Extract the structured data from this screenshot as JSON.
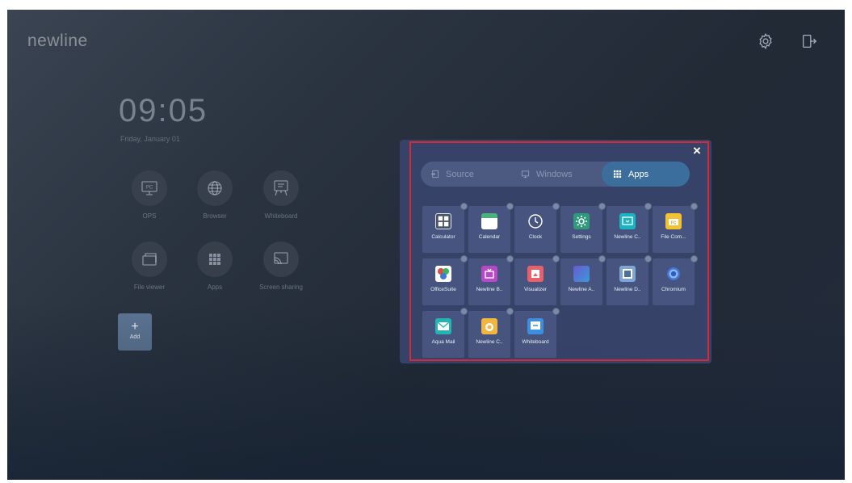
{
  "brand": {
    "logo_text": "newline"
  },
  "top_icons": [
    "gear-icon",
    "exit-icon"
  ],
  "clock": {
    "time": "09:05",
    "date": "Friday, January 01"
  },
  "home": {
    "tiles": [
      {
        "label": "OPS",
        "icon": "pc-icon"
      },
      {
        "label": "Browser",
        "icon": "globe-icon"
      },
      {
        "label": "Whiteboard",
        "icon": "whiteboard-icon"
      },
      {
        "label": "File viewer",
        "icon": "folder-icon"
      },
      {
        "label": "Apps",
        "icon": "apps-grid-icon"
      },
      {
        "label": "Screen sharing",
        "icon": "cast-icon"
      }
    ],
    "add": {
      "plus": "+",
      "label": "Add"
    }
  },
  "panel": {
    "close": "×",
    "tabs": [
      {
        "label": "Source",
        "icon": "source-icon",
        "active": false
      },
      {
        "label": "Windows",
        "icon": "windows-icon",
        "active": false
      },
      {
        "label": "Apps",
        "icon": "apps-grid-icon",
        "active": true
      }
    ],
    "apps": [
      {
        "label": "Calculator",
        "icon": "calculator-icon",
        "color": "#4a5468"
      },
      {
        "label": "Calendar",
        "icon": "calendar-icon",
        "color": "#4bb07a"
      },
      {
        "label": "Clock",
        "icon": "clock-icon",
        "color": "#5a6890"
      },
      {
        "label": "Settings",
        "icon": "settings-icon",
        "color": "#2f9a7c"
      },
      {
        "label": "Newline C..",
        "icon": "newline-cast-icon",
        "color": "#1ab3c0"
      },
      {
        "label": "File Com...",
        "icon": "file-commander-icon",
        "color": "#f2c230"
      },
      {
        "label": "OfficeSuite",
        "icon": "officesuite-icon",
        "color": "#ffffff"
      },
      {
        "label": "Newline B..",
        "icon": "newline-broadcast-icon",
        "color": "#b64ac4"
      },
      {
        "label": "Visualizer",
        "icon": "visualizer-icon",
        "color": "#e8606a"
      },
      {
        "label": "Newline A..",
        "icon": "newline-assistant-icon",
        "color": "#4a4fb0"
      },
      {
        "label": "Newline D..",
        "icon": "newline-display-icon",
        "color": "#7ea6d4"
      },
      {
        "label": "Chromium",
        "icon": "chromium-icon",
        "color": "#3f78d8"
      },
      {
        "label": "Aqua Mail",
        "icon": "aqua-mail-icon",
        "color": "#23b5b5"
      },
      {
        "label": "Newline C..",
        "icon": "newline-cloud-icon",
        "color": "#f0b640"
      },
      {
        "label": "Whiteboard",
        "icon": "whiteboard-app-icon",
        "color": "#3b8ee0"
      }
    ]
  }
}
